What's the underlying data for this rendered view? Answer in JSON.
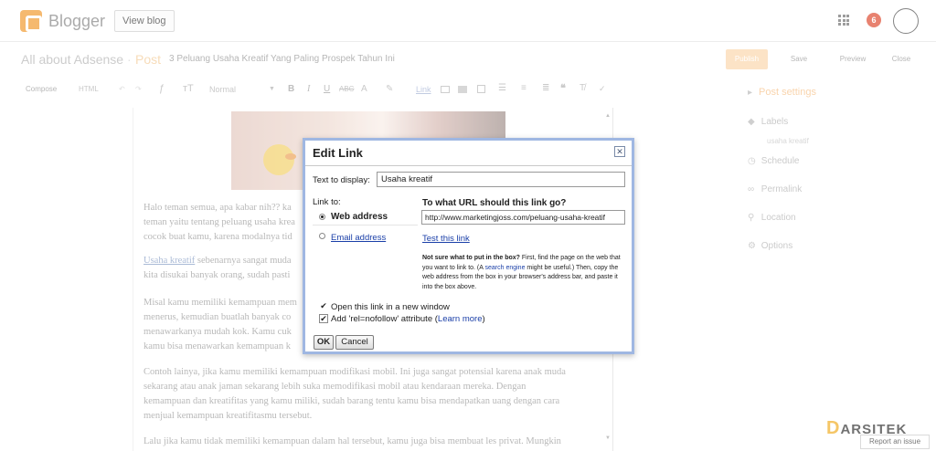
{
  "header": {
    "brand": "Blogger",
    "view_blog": "View blog",
    "notification_count": "6"
  },
  "titlebar": {
    "blog_name": "All about Adsense",
    "separator": "·",
    "section": "Post",
    "post_title": "3 Peluang Usaha Kreatif Yang Paling Prospek Tahun Ini",
    "publish": "Publish",
    "save": "Save",
    "preview": "Preview",
    "close": "Close"
  },
  "toolbar": {
    "compose": "Compose",
    "html": "HTML",
    "format": "Normal",
    "link": "Link"
  },
  "editor": {
    "paragraphs": [
      "Halo teman semua, apa kabar nih?? ka",
      "teman yaitu tentang peluang usaha krea",
      "cocok buat kamu, karena modalnya tid",
      "sebenarnya sangat muda",
      "kita disukai banyak orang, sudah pasti",
      "Misal kamu memiliki kemampuan mem",
      "menerus, kemudian buatlah banyak co",
      "menawarkanya mudah kok. Kamu cuk",
      "kamu bisa menawarkan kemampuan k",
      "Contoh lainya, jika kamu memiliki kemampuan modifikasi mobil. Ini juga sangat potensial karena anak muda",
      "sekarang atau anak jaman sekarang lebih suka memodifikasi mobil atau kendaraan mereka. Dengan",
      "kemampuan dan kreatifitas yang kamu miliki, sudah barang tentu kamu bisa mendapatkan uang dengan cara",
      "menjual kemampuan kreatifitasmu tersebut.",
      "Lalu jika kamu tidak memiliki kemampuan dalam hal tersebut, kamu juga bisa membuat les privat. Mungkin"
    ],
    "link_text": "Usaha kreatif"
  },
  "sidebar": {
    "post_settings": "Post settings",
    "labels": "Labels",
    "labels_value": "usaha kreatif",
    "schedule": "Schedule",
    "permalink": "Permalink",
    "location": "Location",
    "options": "Options"
  },
  "dialog": {
    "title": "Edit Link",
    "close_symbol": "✕",
    "text_to_display_label": "Text to display:",
    "text_to_display_value": "Usaha kreatif",
    "link_to_label": "Link to:",
    "web_address": "Web address",
    "email_address": "Email address",
    "url_question": "To what URL should this link go?",
    "url_value": "http://www.marketingjoss.com/peluang-usaha-kreatif",
    "test_link": "Test this link",
    "help_bold": "Not sure what to put in the box?",
    "help_1": " First, find the page on the web that you want to link to. (A ",
    "help_link": "search engine",
    "help_2": " might be useful.) Then, copy the web address from the box in your browser's address bar, and paste it into the box above.",
    "open_new_window": "Open this link in a new window",
    "nofollow_pre": "Add 'rel=nofollow' attribute (",
    "learn_more": "Learn more",
    "nofollow_post": ")",
    "ok": "OK",
    "cancel": "Cancel"
  },
  "footer": {
    "watermark": "ARSITEK",
    "watermark_d": "D",
    "report": "Report an issue"
  },
  "colors": {
    "accent": "#f29f38",
    "notification": "#e0533a",
    "dialog_border": "#9fb7e2",
    "link": "#1a3fa8"
  }
}
